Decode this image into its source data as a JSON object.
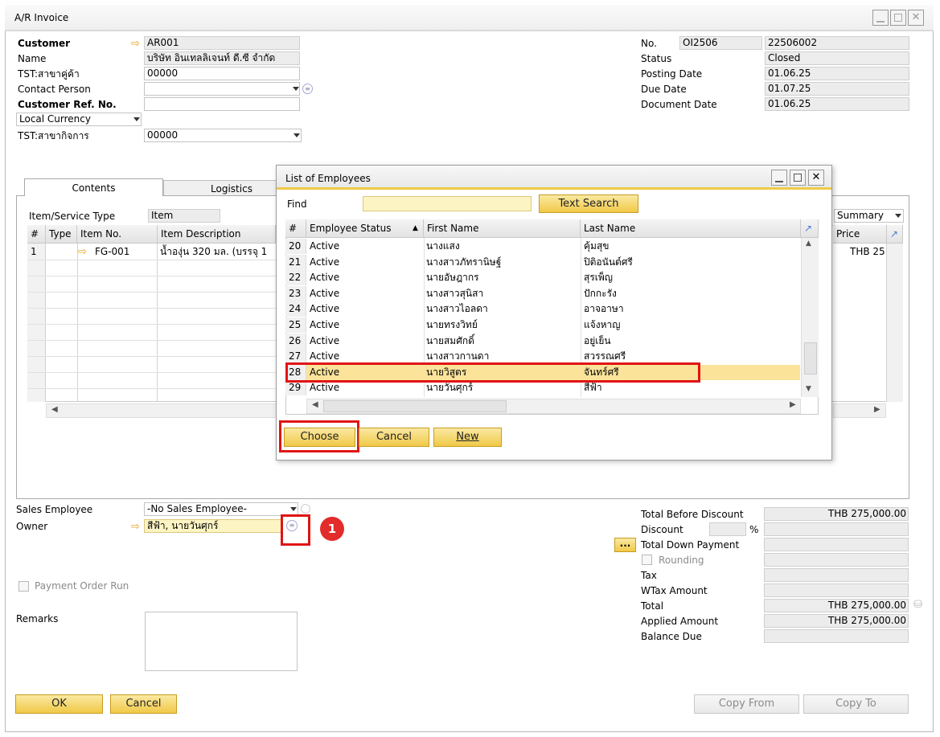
{
  "window": {
    "title": "A/R Invoice"
  },
  "header_left": {
    "customer_label": "Customer",
    "customer_value": "AR001",
    "name_label": "Name",
    "name_value": "บริษัท อินเทลลิเจนท์ ดี.ซี่ จำกัด",
    "branch_label": "TST:สาขาคู่ค้า",
    "branch_value": "00000",
    "contact_label": "Contact Person",
    "contact_value": "",
    "custref_label": "Customer Ref. No.",
    "custref_value": "",
    "currency_value": "Local Currency",
    "bizbranch_label": "TST:สาขากิจการ",
    "bizbranch_value": "00000"
  },
  "header_right": {
    "no_label": "No.",
    "series": "OI2506",
    "doc_no": "22506002",
    "status_label": "Status",
    "status_value": "Closed",
    "posting_label": "Posting Date",
    "posting_value": "01.06.25",
    "due_label": "Due Date",
    "due_value": "01.07.25",
    "docdate_label": "Document Date",
    "docdate_value": "01.06.25"
  },
  "tabs": {
    "contents": "Contents",
    "logistics": "Logistics"
  },
  "contents": {
    "item_type_label": "Item/Service Type",
    "item_type_value": "Item",
    "summary_value": "Summary",
    "columns": [
      "#",
      "Type",
      "Item No.",
      "Item Description"
    ],
    "price_col": "Price",
    "row1": {
      "num": "1",
      "item_no": "FG-001",
      "desc": "น้ำองุ่น 320 มล. (บรรจุ 1",
      "price": "THB 25"
    }
  },
  "dialog": {
    "title": "List of Employees",
    "find_label": "Find",
    "find_value": "",
    "text_search_btn": "Text Search",
    "columns": [
      "#",
      "Employee Status",
      "First Name",
      "Last Name"
    ],
    "rows": [
      {
        "num": "20",
        "status": "Active",
        "first": "นางแสง",
        "last": "คุ้มสุข"
      },
      {
        "num": "21",
        "status": "Active",
        "first": "นางสาวภัทรานิษฐ์",
        "last": "ปิติอนันต์ศรี"
      },
      {
        "num": "22",
        "status": "Active",
        "first": "นายอัษฎากร",
        "last": "สุรเพ็ญ"
      },
      {
        "num": "23",
        "status": "Active",
        "first": "นางสาวสุนิสา",
        "last": "ปักกะรัง"
      },
      {
        "num": "24",
        "status": "Active",
        "first": "นางสาวไอลดา",
        "last": "อาจอาษา"
      },
      {
        "num": "25",
        "status": "Active",
        "first": "นายทรงวิทย์",
        "last": "แจ้งหาญ"
      },
      {
        "num": "26",
        "status": "Active",
        "first": "นายสมศักดิ์",
        "last": "อยู่เย็น"
      },
      {
        "num": "27",
        "status": "Active",
        "first": "นางสาวกานดา",
        "last": "สวรรณศรี"
      },
      {
        "num": "28",
        "status": "Active",
        "first": "นายวิสูตร",
        "last": "จันทร์ศรี"
      },
      {
        "num": "29",
        "status": "Active",
        "first": "นายวันศุกร์",
        "last": "สีฟ้า"
      }
    ],
    "choose_btn": "Choose",
    "cancel_btn": "Cancel",
    "new_btn": "New"
  },
  "bottom_left": {
    "sales_emp_label": "Sales Employee",
    "sales_emp_value": "-No Sales Employee-",
    "owner_label": "Owner",
    "owner_value": "สีฟ้า, นายวันศุกร์",
    "payment_run_label": "Payment Order Run",
    "remarks_label": "Remarks",
    "callout": "1"
  },
  "totals": {
    "before_discount_label": "Total Before Discount",
    "before_discount_value": "THB 275,000.00",
    "discount_label": "Discount",
    "percent_sign": "%",
    "down_payment_label": "Total Down Payment",
    "ellipsis_btn": "...",
    "rounding_label": "Rounding",
    "tax_label": "Tax",
    "wtax_label": "WTax Amount",
    "total_label": "Total",
    "total_value": "THB 275,000.00",
    "applied_label": "Applied Amount",
    "applied_value": "THB 275,000.00",
    "balance_label": "Balance Due"
  },
  "footer": {
    "ok_btn": "OK",
    "cancel_btn": "Cancel",
    "copy_from_btn": "Copy From",
    "copy_to_btn": "Copy To"
  },
  "colors": {
    "accent": "#f0c948",
    "highlight": "#e11414",
    "selected_row": "#fbe39a"
  }
}
